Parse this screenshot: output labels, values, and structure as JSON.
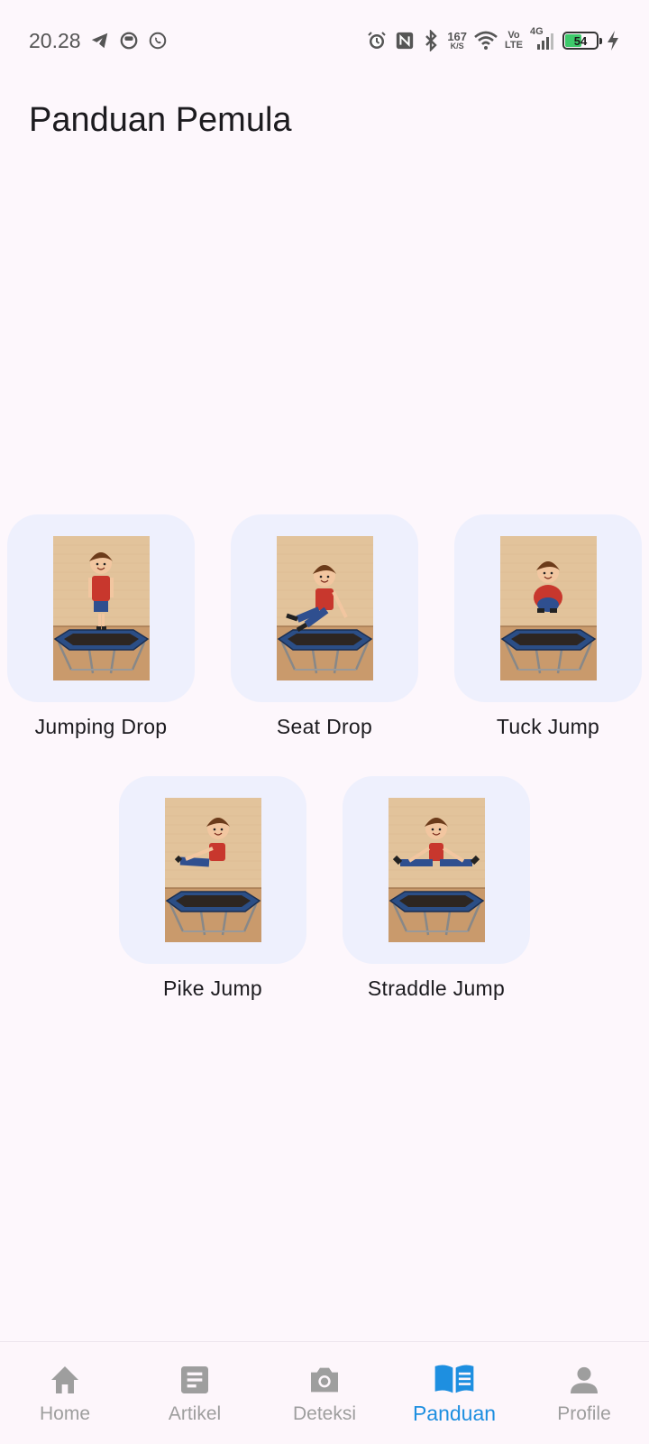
{
  "status_bar": {
    "time": "20.28",
    "left_icons": [
      "telegram-icon",
      "messenger-icon",
      "whatsapp-icon"
    ],
    "right_icons": [
      "alarm-icon",
      "nfc-icon",
      "bluetooth-icon",
      "wifi-icon",
      "signal-icon",
      "charging-icon"
    ],
    "net_speed": "167",
    "net_speed_unit": "K/S",
    "volte_top": "Vo",
    "volte_bottom": "LTE",
    "network_type": "4G",
    "battery_level": "54",
    "battery_fraction": 0.54
  },
  "page": {
    "title": "Panduan Pemula"
  },
  "guides": [
    {
      "label": "Jumping Drop",
      "pose": "jumping"
    },
    {
      "label": "Seat Drop",
      "pose": "seat"
    },
    {
      "label": "Tuck Jump",
      "pose": "tuck"
    },
    {
      "label": "Pike Jump",
      "pose": "pike"
    },
    {
      "label": "Straddle Jump",
      "pose": "straddle"
    }
  ],
  "nav": {
    "items": [
      {
        "label": "Home",
        "icon": "home-icon",
        "active": false
      },
      {
        "label": "Artikel",
        "icon": "article-icon",
        "active": false
      },
      {
        "label": "Deteksi",
        "icon": "camera-icon",
        "active": false
      },
      {
        "label": "Panduan",
        "icon": "book-icon",
        "active": true
      },
      {
        "label": "Profile",
        "icon": "person-icon",
        "active": false
      }
    ]
  },
  "colors": {
    "background": "#fdf7fc",
    "tile": "#eef0fd",
    "accent": "#1e8fe0",
    "nav_inactive": "#9e9e9e",
    "battery": "#3ec96b"
  }
}
